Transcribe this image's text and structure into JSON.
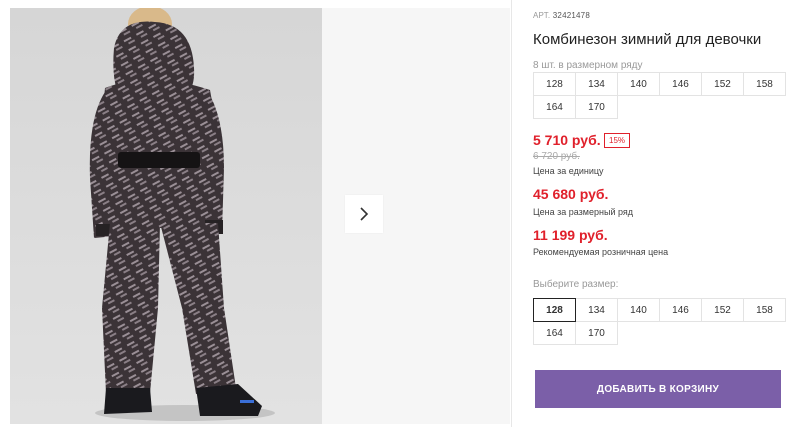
{
  "product": {
    "art_label": "АРТ.",
    "art_number": "32421478",
    "title": "Комбинезон зимний для девочки"
  },
  "size_range": {
    "label": "8 шт. в размерном ряду",
    "sizes": [
      "128",
      "134",
      "140",
      "146",
      "152",
      "158",
      "164",
      "170"
    ]
  },
  "prices": {
    "unit_price": "5 710 руб.",
    "discount": "15%",
    "old_price": "6 720 руб.",
    "unit_caption": "Цена за единицу",
    "range_price": "45 680 руб.",
    "range_caption": "Цена за размерный ряд",
    "retail_price": "11 199 руб.",
    "retail_caption": "Рекомендуемая розничная цена"
  },
  "size_select": {
    "label": "Выберите размер:",
    "selected": "128",
    "sizes": [
      "128",
      "134",
      "140",
      "146",
      "152",
      "158",
      "164",
      "170"
    ]
  },
  "cart": {
    "button_label": "ДОБАВИТЬ В КОРЗИНУ"
  },
  "colors": {
    "accent": "#7b5fa8",
    "price_red": "#e0202b"
  },
  "icons": {
    "next": "chevron-right-icon"
  }
}
